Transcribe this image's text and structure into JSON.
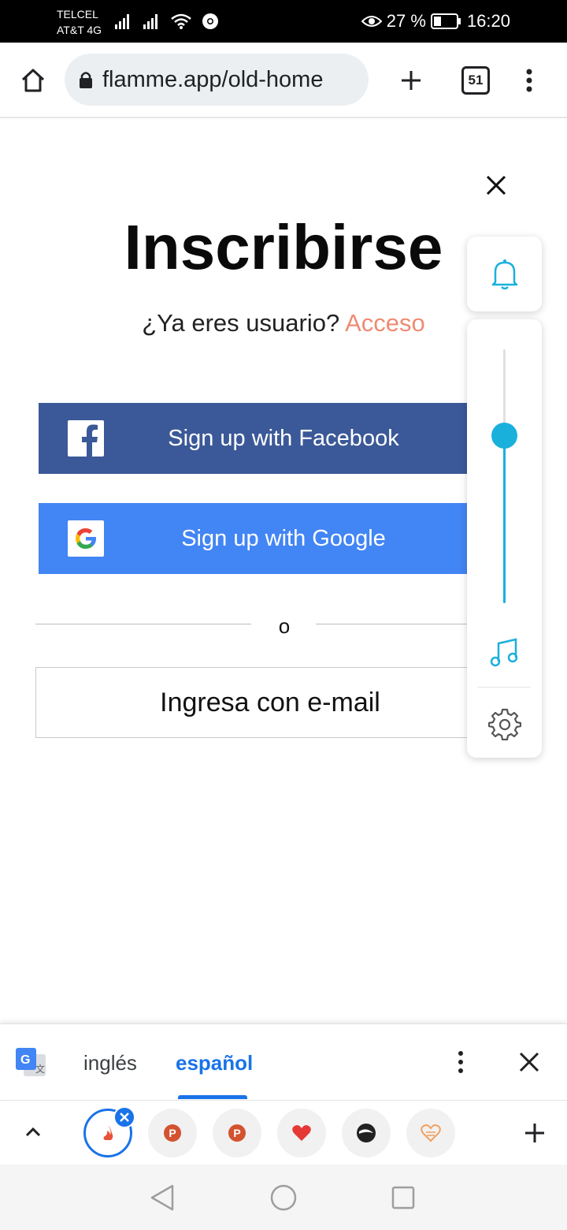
{
  "status_bar": {
    "carrier_1": "TELCEL",
    "carrier_2": "AT&T 4G",
    "battery": "27 %",
    "time": "16:20"
  },
  "browser": {
    "url": "flamme.app/old-home",
    "tab_count": "51"
  },
  "signup": {
    "title": "Inscribirse",
    "existing_user_prompt": "¿Ya eres usuario?",
    "login_link": "Acceso",
    "facebook_button": "Sign up with Facebook",
    "google_button": "Sign up with Google",
    "or_separator": "o",
    "email_button": "Ingresa con e-mail"
  },
  "volume_panel": {
    "level": 0.66,
    "accent_color": "#1ab0dc"
  },
  "translate_bar": {
    "source_language": "inglés",
    "target_language": "español"
  },
  "tab_strip": {
    "tabs": [
      {
        "icon": "flamme-favicon",
        "active": true
      },
      {
        "icon": "p-favicon",
        "active": false
      },
      {
        "icon": "p-favicon",
        "active": false
      },
      {
        "icon": "heart-favicon",
        "active": false
      },
      {
        "icon": "dark-circle-favicon",
        "active": false
      },
      {
        "icon": "heart-outline-favicon",
        "active": false
      }
    ]
  },
  "colors": {
    "facebook": "#3b5998",
    "google": "#4285f4",
    "login_link": "#ef8b74",
    "translate_accent": "#1a73e8"
  }
}
